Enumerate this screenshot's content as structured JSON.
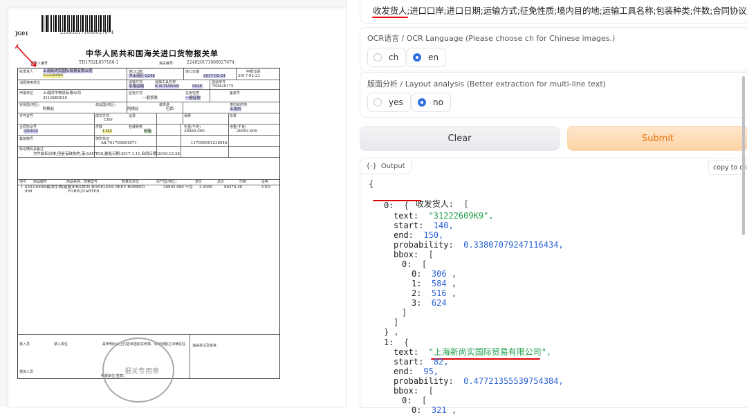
{
  "document": {
    "code": "JG01",
    "barcode_number": "224820171000027674",
    "title": "中华人民共和国海关进口货物报关单",
    "pre_entry_label": "预录入编号:",
    "pre_entry_value": "TH1702L057186-1",
    "customs_no_label": "海关编号:",
    "customs_no_value": "224820171000027674",
    "fields": {
      "consignee_label": "收发货人",
      "consignee_value": "上海新尚实国际贸易有限公司",
      "consignee_code": "31222609K9",
      "import_port_label": "进口口岸",
      "import_port_value": "洋山港区-2248",
      "import_date_label": "进口日期",
      "import_date_value": "2017-02-24",
      "declare_date_label": "申报日期",
      "declare_date_value": "2017-02-23",
      "consumer_label": "消费使用单位",
      "transport_label": "运输方式",
      "transport_value": "水路运输",
      "vehicle_label": "运输工具名称",
      "vehicle_value": "K.N.TIANAN",
      "vehicle_no": "004E",
      "bl_label": "提运单号",
      "bl_value": "769428175",
      "declarant_label": "申报单位",
      "declarant_value": "上海同华物流有限公司",
      "declarant_code": "3116680016",
      "supervision_label": "监管方式",
      "supervision_value": "一般贸易",
      "tax_label": "征免性质",
      "tax_value": "一般征税",
      "record_label": "备案号",
      "trade_country_label": "贸易国(地区)",
      "trade_country_value": "阿根廷",
      "origin_label": "启运国(地区)",
      "origin_value": "阿根廷",
      "port_label": "装货港",
      "port_value": "巴西",
      "dest_label": "境内目的地",
      "dest_value": "上海市",
      "license_label": "许可证号",
      "deal_label": "成交方式",
      "deal_value": "CNF",
      "freight_label": "运费",
      "insurance_label": "保费",
      "misc_label": "杂费",
      "contract_label": "合同协议号",
      "contract_value": "320035",
      "pieces_label": "件数",
      "pieces_value": "1142",
      "package_label": "包装种类",
      "package_value": "纸箱",
      "gross_label": "毛重(千克)",
      "gross_value": "28060.000",
      "net_label": "净重(千克)",
      "net_value": "26992.000",
      "container_label": "集装箱号",
      "docs_label": "随附单证",
      "docs_value": "A8:7017090E4571",
      "docs_no": "117000001219546",
      "remarks_label": "标记唛码及备注",
      "remarks_value": "为牛前四分体,但是有缺失的,港:SANTOS,装船日期:2017.1.11,合同日期:2016.12.28"
    },
    "goods_header": [
      "项号",
      "商品编号",
      "商品名称、规格型号",
      "数量及单位",
      "原产国(地区)",
      "单价",
      "总价",
      "币制",
      "征免"
    ],
    "goods_row": [
      "1",
      "0202300090",
      "冷冻牛肉(前肢)FROZEN BONELESS BEEF ROBBED",
      "26992.000 千克",
      "3.2000",
      "86374.40",
      "USD"
    ],
    "goods_row_2": [
      "999",
      "FOREQUARTER"
    ],
    "footer": {
      "entry_person": "录入员",
      "entry_unit": "录入单位",
      "statement": "兹申明对以上内容承担如实申报、依法纳税之法律责任",
      "customs_note": "海关批注及签章",
      "declarant": "报关人员",
      "declare_unit": "申报单位(签章)",
      "stamp_text": "报关专用章"
    }
  },
  "right_panel": {
    "fields_text": "收发货人;进口口岸;进口日期;运输方式;征免性质;境内目的地;运输工具名称;包装种类;件数;合同协议号",
    "ocr_language_label": "OCR语言 / OCR Language (Please choose ch for Chinese images.)",
    "ocr_options": [
      "ch",
      "en"
    ],
    "ocr_selected": "en",
    "layout_label": "版面分析 / Layout analysis (Better extraction for multi-line text)",
    "layout_options": [
      "yes",
      "no"
    ],
    "layout_selected": "no",
    "clear_label": "Clear",
    "submit_label": "Submit",
    "output_label": "Output",
    "copy_label": "copy to cli"
  },
  "json_output": {
    "key_main": "收发货人:",
    "item0": {
      "index": "0:",
      "text_key": "text:",
      "text_value": "\"31222609K9\",",
      "start_key": "start:",
      "start_value": "140,",
      "end_key": "end:",
      "end_value": "150,",
      "prob_key": "probability:",
      "prob_value": "0.33807079247116434,",
      "bbox_key": "bbox:",
      "bbox_inner": "0:",
      "bbox": [
        {
          "i": "0:",
          "v": "306"
        },
        {
          "i": "1:",
          "v": "584"
        },
        {
          "i": "2:",
          "v": "516"
        },
        {
          "i": "3:",
          "v": "624"
        }
      ]
    },
    "item1": {
      "index": "1:",
      "text_key": "text:",
      "text_value": "\"上海新尚实国际贸易有限公司\",",
      "start_key": "start:",
      "start_value": "82,",
      "end_key": "end:",
      "end_value": "95,",
      "prob_key": "probability:",
      "prob_value": "0.47721355539754384,",
      "bbox_key": "bbox:",
      "bbox_inner": "0:",
      "bbox_first": {
        "i": "0:",
        "v": "321"
      }
    }
  },
  "colors": {
    "accent_blue": "#2f6fe0",
    "submit_orange": "#e8700a",
    "json_string": "#1e9e4a",
    "json_number": "#2a62d6",
    "annotation_red": "#d00000"
  }
}
